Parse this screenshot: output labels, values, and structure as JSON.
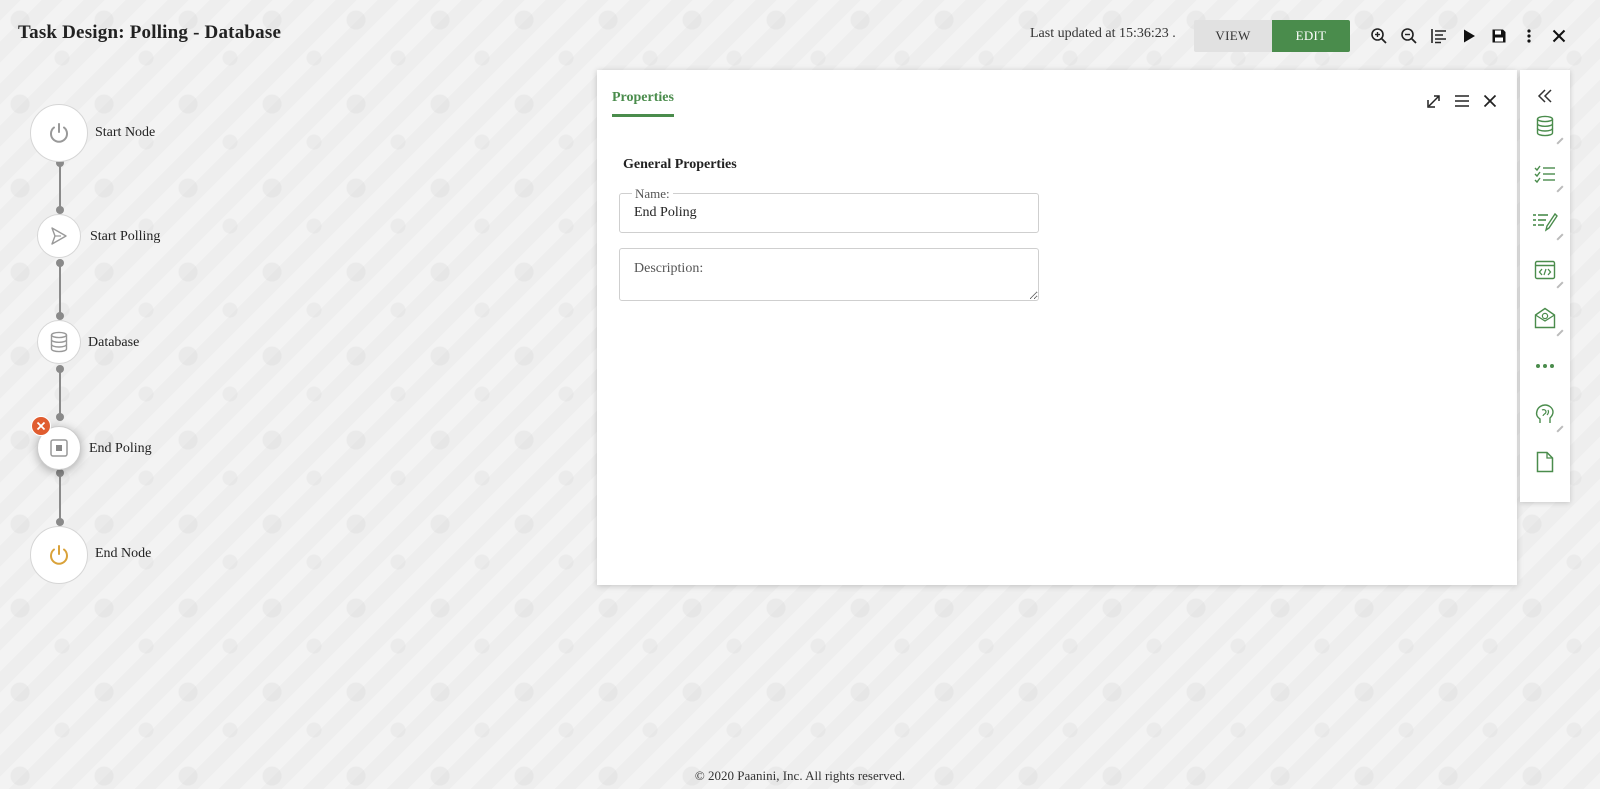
{
  "header": {
    "title": "Task Design: Polling - Database",
    "last_updated": "Last updated at 15:36:23 .",
    "view_label": "VIEW",
    "edit_label": "EDIT"
  },
  "toolbar_icons": [
    "zoom-in-icon",
    "zoom-out-icon",
    "align-icon",
    "play-icon",
    "save-icon",
    "more-vertical-icon",
    "close-icon"
  ],
  "flow": {
    "nodes": [
      {
        "label": "Start Node",
        "icon": "power-icon"
      },
      {
        "label": "Start Polling",
        "icon": "send-icon"
      },
      {
        "label": "Database",
        "icon": "database-icon"
      },
      {
        "label": "End Poling",
        "icon": "stop-icon",
        "selected": true
      },
      {
        "label": "End Node",
        "icon": "power-icon",
        "accent": "#d9a23a"
      }
    ]
  },
  "properties": {
    "tab_label": "Properties",
    "section_title": "General Properties",
    "name_label": "Name:",
    "name_value": "End Poling",
    "description_label": "Description:"
  },
  "toolbox_icons": [
    "collapse-icon",
    "database-icon",
    "checklist-icon",
    "edit-list-icon",
    "code-window-icon",
    "email-icon",
    "more-horizontal-icon",
    "brain-icon",
    "document-icon"
  ],
  "colors": {
    "accent_green": "#4a8c4c",
    "delete_orange": "#e05c2f",
    "end_node_gold": "#d9a23a"
  },
  "footer": "© 2020 Paanini, Inc. All rights reserved."
}
